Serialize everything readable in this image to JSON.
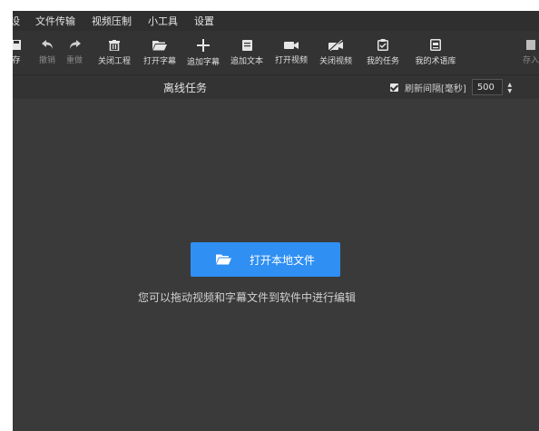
{
  "menu": {
    "partial": "设",
    "items": [
      "文件传输",
      "视频压制",
      "小工具",
      "设置"
    ]
  },
  "toolbar": {
    "save_partial": "存",
    "undo": "撤销",
    "redo": "重做",
    "close_project": "关闭工程",
    "open_subtitle": "打开字幕",
    "add_subtitle": "追加字幕",
    "add_text": "追加文本",
    "open_video": "打开视频",
    "close_video": "关闭视频",
    "my_tasks": "我的任务",
    "my_glossary": "我的术语库",
    "save_as_partial": "存入"
  },
  "subheader": {
    "title": "离线任务",
    "refresh_label": "刷新间隔[毫秒]",
    "refresh_checked": true,
    "refresh_value": "500"
  },
  "main": {
    "open_button": "打开本地文件",
    "hint": "您可以拖动视频和字幕文件到软件中进行编辑"
  },
  "colors": {
    "accent": "#2f8ff3",
    "background": "#3a3a3a",
    "toolbar": "#333333"
  }
}
